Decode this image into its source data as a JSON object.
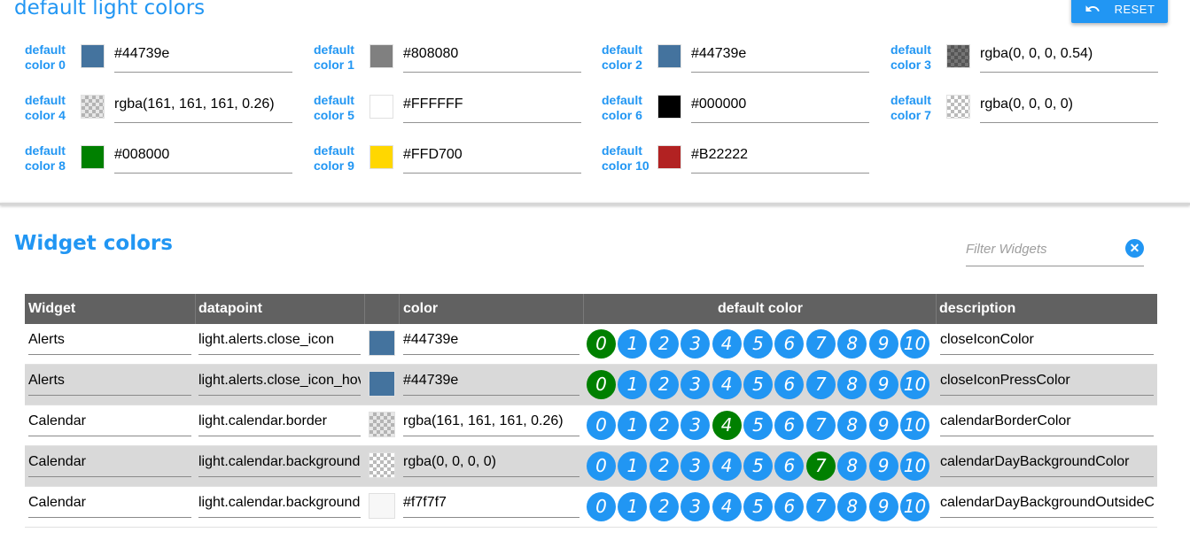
{
  "default_colors": {
    "title": "default light colors",
    "reset_label": "RESET",
    "items": [
      {
        "label": "default color 0",
        "value": "#44739e",
        "swatch": "#44739e"
      },
      {
        "label": "default color 1",
        "value": "#808080",
        "swatch": "#808080"
      },
      {
        "label": "default color 2",
        "value": "#44739e",
        "swatch": "#44739e"
      },
      {
        "label": "default color 3",
        "value": "rgba(0, 0, 0, 0.54)",
        "swatch": "rgba(0, 0, 0, 0.54)"
      },
      {
        "label": "default color 4",
        "value": "rgba(161, 161, 161, 0.26)",
        "swatch": "rgba(161, 161, 161, 0.26)"
      },
      {
        "label": "default color 5",
        "value": "#FFFFFF",
        "swatch": "#FFFFFF"
      },
      {
        "label": "default color 6",
        "value": "#000000",
        "swatch": "#000000"
      },
      {
        "label": "default color 7",
        "value": "rgba(0, 0, 0, 0)",
        "swatch": "rgba(0, 0, 0, 0)"
      },
      {
        "label": "default color 8",
        "value": "#008000",
        "swatch": "#008000"
      },
      {
        "label": "default color 9",
        "value": "#FFD700",
        "swatch": "#FFD700"
      },
      {
        "label": "default color 10",
        "value": "#B22222",
        "swatch": "#B22222"
      }
    ]
  },
  "widget_colors": {
    "title": "Widget colors",
    "filter_placeholder": "Filter Widgets",
    "clear_icon": "close-icon",
    "columns": {
      "widget": "Widget",
      "datapoint": "datapoint",
      "color": "color",
      "default_color": "default color",
      "description": "description"
    },
    "circle_labels": [
      "0",
      "1",
      "2",
      "3",
      "4",
      "5",
      "6",
      "7",
      "8",
      "9",
      "10"
    ],
    "rows": [
      {
        "widget": "Alerts",
        "datapoint": "light.alerts.close_icon",
        "color": "#44739e",
        "swatch": "#44739e",
        "selected": 0,
        "description": "closeIconColor"
      },
      {
        "widget": "Alerts",
        "datapoint": "light.alerts.close_icon_hover",
        "color": "#44739e",
        "swatch": "#44739e",
        "selected": 0,
        "description": "closeIconPressColor"
      },
      {
        "widget": "Calendar",
        "datapoint": "light.calendar.border",
        "color": "rgba(161, 161, 161, 0.26)",
        "swatch": "rgba(161, 161, 161, 0.26)",
        "selected": 4,
        "description": "calendarBorderColor"
      },
      {
        "widget": "Calendar",
        "datapoint": "light.calendar.background",
        "color": "rgba(0, 0, 0, 0)",
        "swatch": "rgba(0, 0, 0, 0)",
        "selected": 7,
        "description": "calendarDayBackgroundColor"
      },
      {
        "widget": "Calendar",
        "datapoint": "light.calendar.background",
        "color": "#f7f7f7",
        "swatch": "#f7f7f7",
        "selected": -1,
        "description": "calendarDayBackgroundOutsideColor"
      }
    ]
  }
}
